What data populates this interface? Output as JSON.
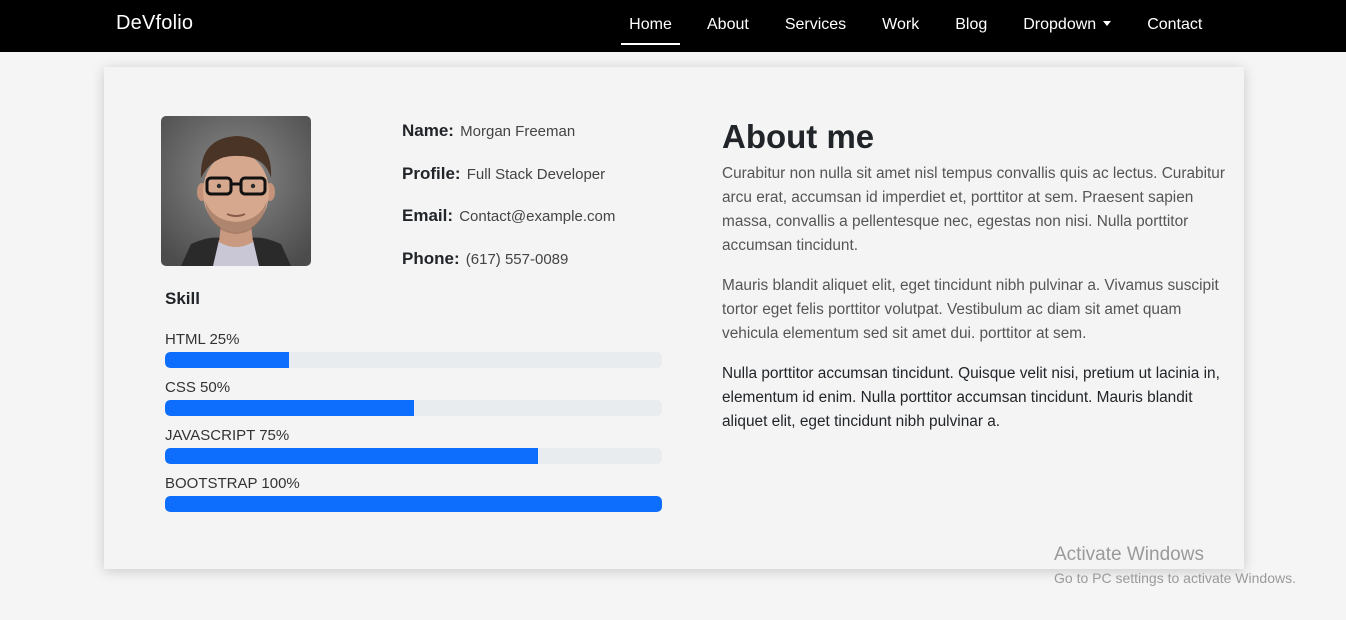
{
  "navbar": {
    "brand": "DeVfolio",
    "items": [
      {
        "label": "Home",
        "active": true
      },
      {
        "label": "About"
      },
      {
        "label": "Services"
      },
      {
        "label": "Work"
      },
      {
        "label": "Blog"
      },
      {
        "label": "Dropdown",
        "icon": "caret-down-icon"
      },
      {
        "label": "Contact"
      }
    ]
  },
  "profile": {
    "name_label": "Name:",
    "name": "Morgan Freeman",
    "profile_label": "Profile:",
    "profile": "Full Stack Developer",
    "email_label": "Email:",
    "email": "Contact@example.com",
    "phone_label": "Phone:",
    "phone": "(617) 557-0089"
  },
  "skills": {
    "title": "Skill",
    "items": [
      {
        "label": "HTML 25%",
        "percent": 25
      },
      {
        "label": "CSS 50%",
        "percent": 50
      },
      {
        "label": "JAVASCRIPT 75%",
        "percent": 75
      },
      {
        "label": "BOOTSTRAP 100%",
        "percent": 100
      }
    ]
  },
  "about": {
    "title": "About me",
    "paragraphs": [
      "Curabitur non nulla sit amet nisl tempus convallis quis ac lectus. Curabitur arcu erat, accumsan id imperdiet et, porttitor at sem. Praesent sapien massa, convallis a pellentesque nec, egestas non nisi. Nulla porttitor accumsan tincidunt.",
      "Mauris blandit aliquet elit, eget tincidunt nibh pulvinar a. Vivamus suscipit tortor eget felis porttitor volutpat. Vestibulum ac diam sit amet quam vehicula elementum sed sit amet dui. porttitor at sem.",
      "Nulla porttitor accumsan tincidunt. Quisque velit nisi, pretium ut lacinia in, elementum id enim. Nulla porttitor accumsan tincidunt. Mauris blandit aliquet elit, eget tincidunt nibh pulvinar a."
    ]
  },
  "watermark": {
    "title": "Activate Windows",
    "subtitle": "Go to PC settings to activate Windows."
  },
  "colors": {
    "navbar_bg": "#000000",
    "accent": "#0d6efd",
    "page_bg": "#f5f5f5"
  }
}
